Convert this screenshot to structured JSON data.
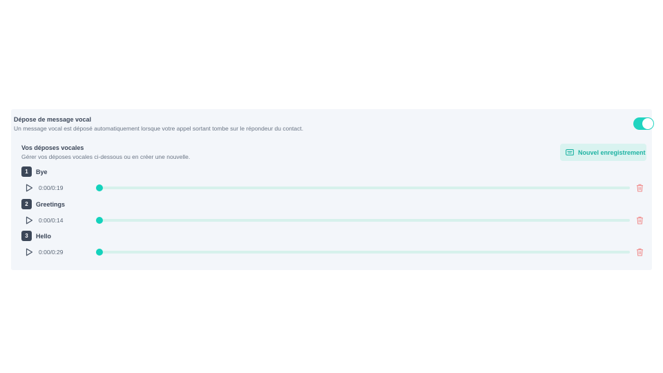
{
  "setting": {
    "title": "Dépose de message vocal",
    "description": "Un message vocal est déposé automatiquement lorsque votre appel sortant tombe sur le répondeur du contact.",
    "toggle_on": true
  },
  "section": {
    "title": "Vos déposes vocales",
    "description": "Gérer vos déposes vocales ci-dessous ou en créer une nouvelle.",
    "new_button_label": "Nouvel enregistrement"
  },
  "voicemails": [
    {
      "number": "1",
      "name": "Bye",
      "time": "0:00/0:19",
      "progress": 0
    },
    {
      "number": "2",
      "name": "Greetings",
      "time": "0:00/0:14",
      "progress": 0
    },
    {
      "number": "3",
      "name": "Hello",
      "time": "0:00/0:29",
      "progress": 0
    }
  ],
  "colors": {
    "accent": "#13d2bc",
    "toggle": "#20d4c0",
    "delete": "#f08a8a",
    "badge": "#3c4758"
  },
  "icons": {
    "record": "record-icon",
    "play": "play-icon",
    "delete": "trash-icon"
  }
}
